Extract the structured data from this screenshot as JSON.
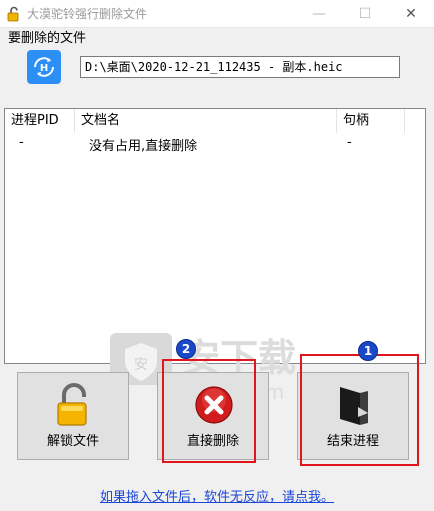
{
  "window": {
    "title": "大漠驼铃强行删除文件",
    "minimize": "—",
    "maximize": "☐",
    "close": "✕"
  },
  "file_section": {
    "label": "要删除的文件",
    "path_value": "D:\\桌面\\2020-12-21_112435 - 副本.heic",
    "file_icon": "heic-file-icon"
  },
  "process_list": {
    "columns": [
      "进程PID",
      "文档名",
      "句柄"
    ],
    "rows": [
      {
        "pid": "-",
        "name": "没有占用,直接删除",
        "handle": "-"
      }
    ]
  },
  "watermark": {
    "brand": "安下载",
    "domain": "anxz.com"
  },
  "buttons": {
    "unlock": {
      "label": "解锁文件",
      "icon": "padlock-open-icon"
    },
    "delete": {
      "label": "直接删除",
      "icon": "red-x-icon"
    },
    "end_process": {
      "label": "结束进程",
      "icon": "black-folder-icon"
    }
  },
  "annotations": {
    "badge_1": "1",
    "badge_2": "2",
    "frame_color": "#e0161c",
    "badge_color": "#1948c9"
  },
  "help_link": "如果拖入文件后，软件无反应，请点我。"
}
